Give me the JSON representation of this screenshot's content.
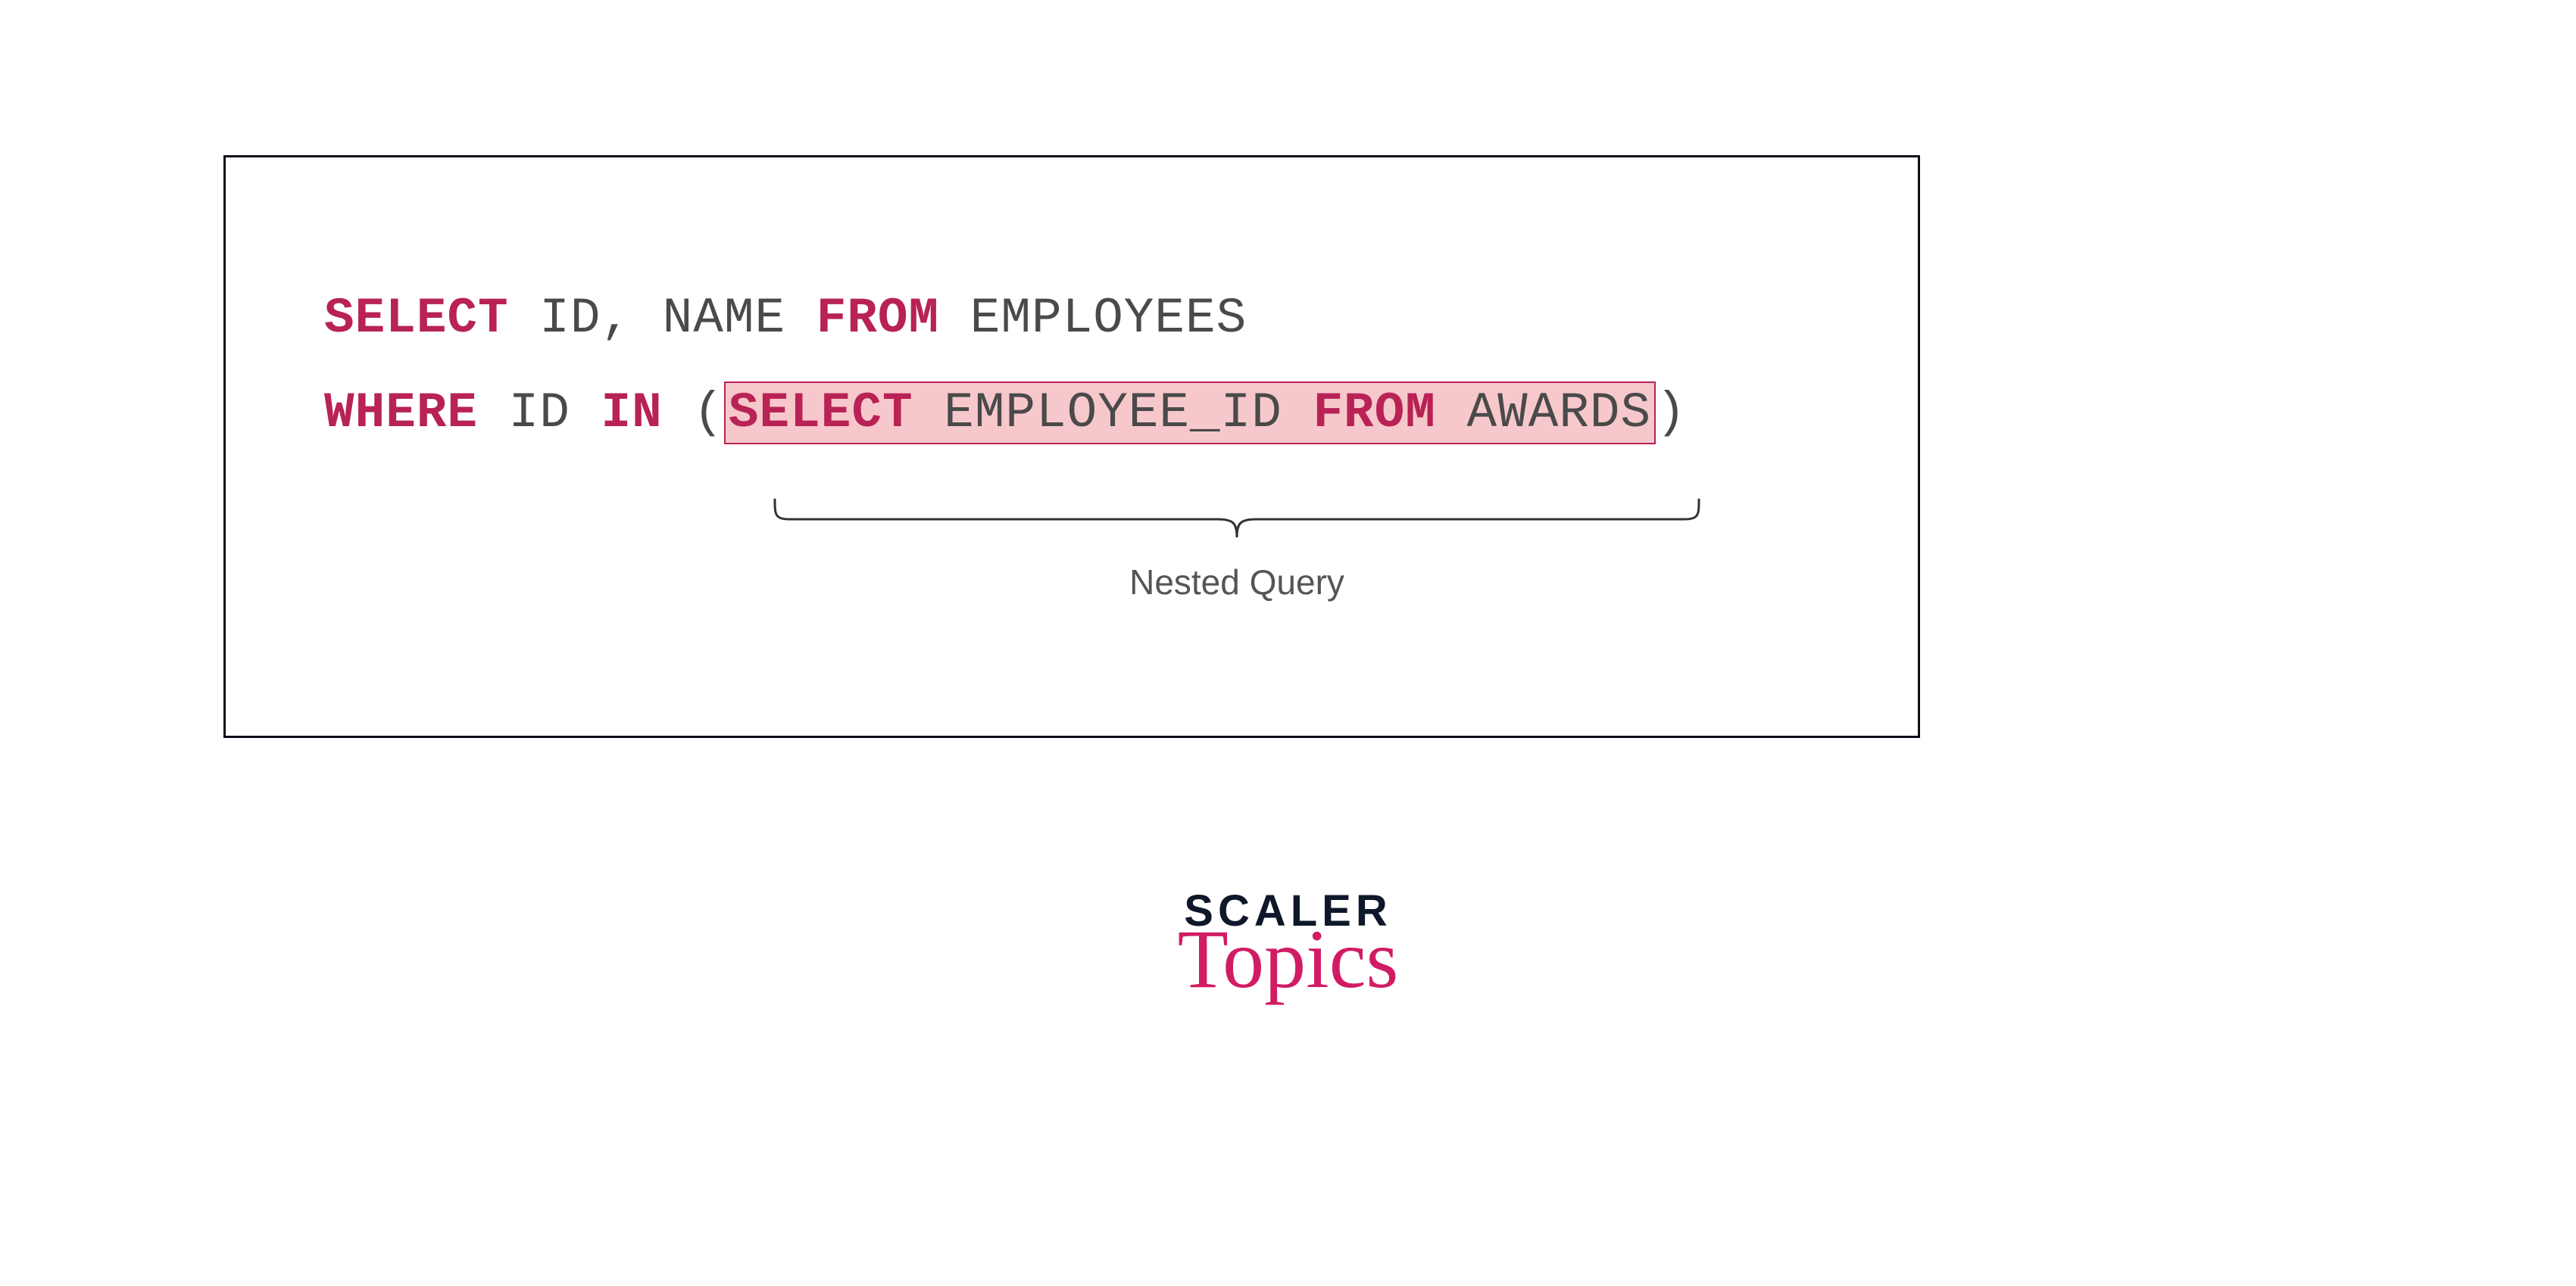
{
  "code": {
    "line1": {
      "select": "SELECT",
      "cols": " ID, NAME ",
      "from": "FROM",
      "table": " EMPLOYEES"
    },
    "line2": {
      "where": "WHERE",
      "col": " ID ",
      "in": "IN",
      "open": " (",
      "inner_select": "SELECT",
      "inner_col": " EMPLOYEE_ID ",
      "inner_from": "FROM",
      "inner_table": " AWARDS",
      "close": ")"
    }
  },
  "annotation": {
    "label": "Nested Query"
  },
  "logo": {
    "main": "SCALER",
    "sub": "Topics"
  }
}
